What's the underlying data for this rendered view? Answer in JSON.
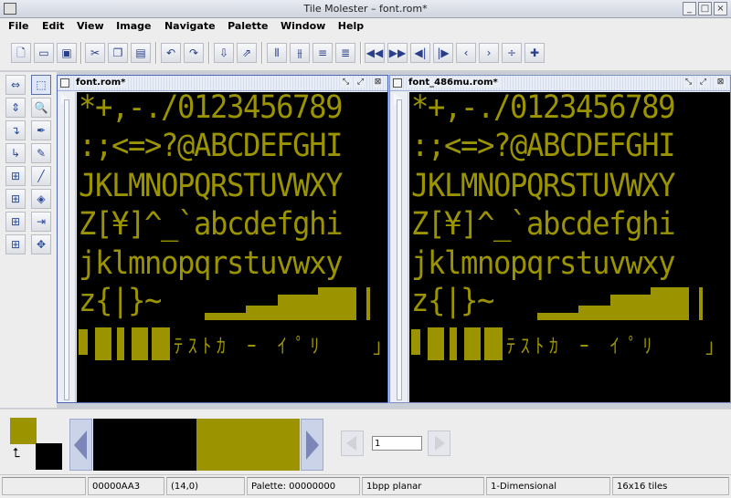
{
  "window": {
    "title": "Tile Molester – font.rom*"
  },
  "menu": [
    "File",
    "Edit",
    "View",
    "Image",
    "Navigate",
    "Palette",
    "Window",
    "Help"
  ],
  "toolbar_icons": [
    "new-icon",
    "open-icon",
    "save-icon",
    "cut-icon",
    "copy-icon",
    "paste-icon",
    "undo-icon",
    "redo-icon",
    "import-icon",
    "export-icon",
    "col-minus-icon",
    "col-plus-icon",
    "row-minus-icon",
    "row-plus-icon",
    "page-back-icon",
    "page-forward-icon",
    "row-back-icon",
    "row-forward-icon",
    "byte-back-icon",
    "byte-forward-icon",
    "tile-minus-icon",
    "tile-plus-icon"
  ],
  "tools": [
    "hflip",
    "zoom",
    "vflip",
    "pick",
    "rot-cw",
    "pencil",
    "rot-ccw",
    "line",
    "shift-left",
    "fill",
    "shift-right",
    "replace",
    "shift-up",
    "move",
    "shift-down"
  ],
  "frames": [
    {
      "title": "font.rom*",
      "lines": [
        "*+,-./0123456789",
        ":;<=>?@ABCDEFGHI",
        "JKLMNOPQRSTUVWXY",
        "Z[¥]^_`abcdefghi",
        "jklmnopqrstuvwxy",
        "z{|}~"
      ],
      "kana": "ﾃｽﾄｶ ｰ ｲ ﾟﾘ   ｣ ､.ｦｧｨｩ"
    },
    {
      "title": "font_486mu.rom*",
      "lines": [
        "*+,-./0123456789",
        ":;<=>?@ABCDEFGHI",
        "JKLMNOPQRSTUVWXY",
        "Z[¥]^_`abcdefghi",
        "jklmnopqrstuvwxy",
        "z{|}~"
      ],
      "kana": "ﾃｽﾄｶ ｰ ｲ ﾟﾘ   ｣ ､.ｦｧｨｩ"
    }
  ],
  "palette": {
    "fg_color": "#9b9400",
    "bg_color": "#000000",
    "swatches": [
      "#000000",
      "#000000",
      "#9b9400",
      "#9b9400"
    ],
    "page_value": "1"
  },
  "status": {
    "offset": "00000AA3",
    "coords": "(14,0)",
    "palette": "Palette: 00000000",
    "codec": "1bpp planar",
    "mode": "1-Dimensional",
    "tiles": "16x16 tiles"
  }
}
